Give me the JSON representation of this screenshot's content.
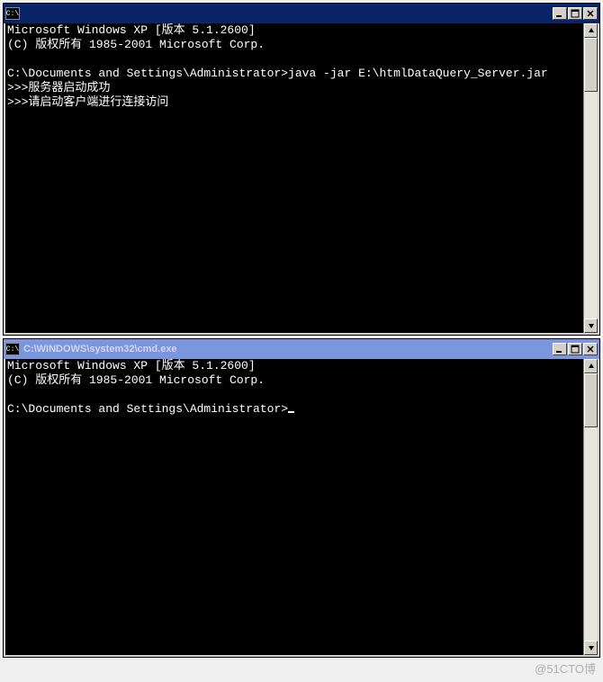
{
  "window1": {
    "title": " ",
    "lines": {
      "l1": "Microsoft Windows XP [版本 5.1.2600]",
      "l2": "(C) 版权所有 1985-2001 Microsoft Corp.",
      "l3": "",
      "l4": "C:\\Documents and Settings\\Administrator>java -jar E:\\htmlDataQuery_Server.jar",
      "l5": ">>>服务器启动成功",
      "l6": ">>>请启动客户端进行连接访问"
    }
  },
  "window2": {
    "title": "C:\\WINDOWS\\system32\\cmd.exe",
    "lines": {
      "l1": "Microsoft Windows XP [版本 5.1.2600]",
      "l2": "(C) 版权所有 1985-2001 Microsoft Corp.",
      "l3": "",
      "l4_prefix": "C:\\Documents and Settings\\Administrator>"
    }
  },
  "watermark": "@51CTO博"
}
